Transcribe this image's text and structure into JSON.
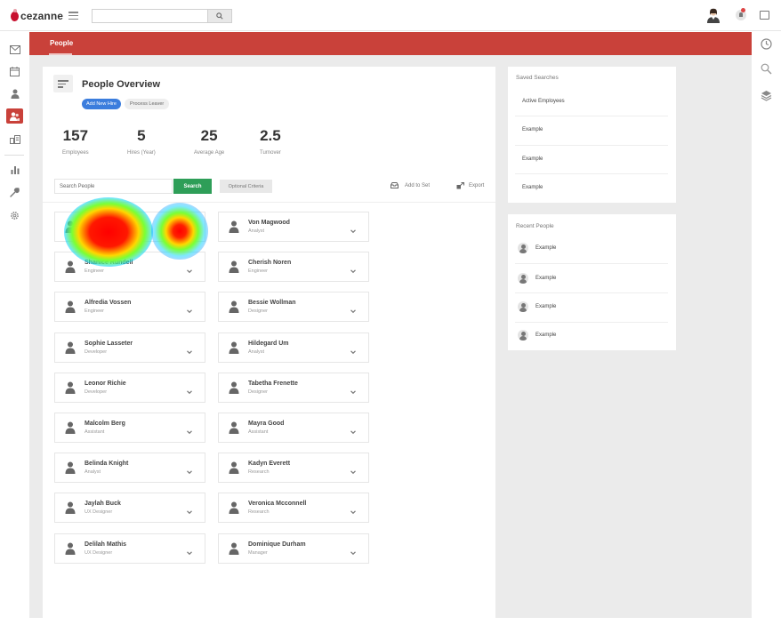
{
  "app": {
    "logo_text": "cezanne"
  },
  "topbar": {
    "search_placeholder": ""
  },
  "tabs": {
    "active": "People"
  },
  "overview": {
    "title": "People Overview",
    "add_new_hire": "Add New Hire",
    "process_leaver": "Process Leaver",
    "stats": [
      {
        "value": "157",
        "label": "Employees"
      },
      {
        "value": "5",
        "label": "Hires (Year)"
      },
      {
        "value": "25",
        "label": "Average Age"
      },
      {
        "value": "2.5",
        "label": "Turnover"
      }
    ],
    "search_placeholder": "Search People",
    "search_button": "Search",
    "optional_criteria": "Optional Criteria",
    "add_to_set": "Add to Set",
    "export": "Export"
  },
  "people": [
    {
      "name": "",
      "role": ""
    },
    {
      "name": "Von Magwood",
      "role": "Analyst"
    },
    {
      "name": "Shanice Rundell",
      "role": "Engineer"
    },
    {
      "name": "Cherish Noren",
      "role": "Engineer"
    },
    {
      "name": "Alfredia Vossen",
      "role": "Engineer"
    },
    {
      "name": "Bessie Wollman",
      "role": "Designer"
    },
    {
      "name": "Sophie Lasseter",
      "role": "Developer"
    },
    {
      "name": "Hildegard Um",
      "role": "Analyst"
    },
    {
      "name": "Leonor Richie",
      "role": "Developer"
    },
    {
      "name": "Tabetha Frenette",
      "role": "Designer"
    },
    {
      "name": "Malcolm Berg",
      "role": "Assistant"
    },
    {
      "name": "Mayra Good",
      "role": "Assistant"
    },
    {
      "name": "Belinda Knight",
      "role": "Analyst"
    },
    {
      "name": "Kadyn Everett",
      "role": "Research"
    },
    {
      "name": "Jaylah Buck",
      "role": "UX Designer"
    },
    {
      "name": "Veronica Mcconnell",
      "role": "Research"
    },
    {
      "name": "Delilah Mathis",
      "role": "UX Designer"
    },
    {
      "name": "Dominique Durham",
      "role": "Manager"
    }
  ],
  "saved_searches": {
    "title": "Saved Searches",
    "items": [
      "Active Employees",
      "Example",
      "Example",
      "Example"
    ]
  },
  "recent_people": {
    "title": "Recent People",
    "items": [
      "Example",
      "Example",
      "Example",
      "Example"
    ]
  },
  "colors": {
    "brand_red": "#c9413a",
    "primary_blue": "#3b7ddd",
    "search_green": "#2e9e58"
  },
  "icons": {
    "sidebar": [
      "mail-icon",
      "calendar-icon",
      "person-icon",
      "people-icon",
      "org-chart-icon",
      "bar-chart-icon",
      "wrench-icon",
      "gear-icon"
    ],
    "rightbar": [
      "clock-icon",
      "search-icon",
      "layers-icon"
    ]
  }
}
